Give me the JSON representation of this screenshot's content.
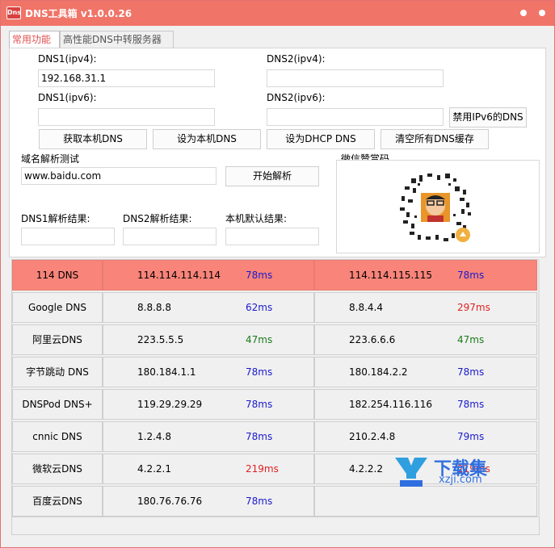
{
  "window": {
    "icon_text": "Dns",
    "title": "DNS工具箱 v1.0.0.26"
  },
  "tabs": [
    {
      "label": "常用功能"
    },
    {
      "label": "高性能DNS中转服务器"
    }
  ],
  "dns_settings": {
    "dns1_ipv4_label": "DNS1(ipv4):",
    "dns1_ipv4_value": "192.168.31.1",
    "dns2_ipv4_label": "DNS2(ipv4):",
    "dns2_ipv4_value": "",
    "dns1_ipv6_label": "DNS1(ipv6):",
    "dns1_ipv6_value": "",
    "dns2_ipv6_label": "DNS2(ipv6):",
    "dns2_ipv6_value": "",
    "disable_ipv6_button": "禁用IPv6的DNS"
  },
  "actions": {
    "get_local_dns": "获取本机DNS",
    "set_local_dns": "设为本机DNS",
    "set_dhcp_dns": "设为DHCP DNS",
    "clear_cache": "清空所有DNS缓存"
  },
  "resolve_test": {
    "section_label": "域名解析测试",
    "domain_value": "www.baidu.com",
    "start_button": "开始解析",
    "dns1_result_label": "DNS1解析结果:",
    "dns2_result_label": "DNS2解析结果:",
    "local_result_label": "本机默认结果:",
    "dns1_result_value": "",
    "dns2_result_value": "",
    "local_result_value": ""
  },
  "donate": {
    "label": "微信赞赏码"
  },
  "servers": [
    {
      "name": "114 DNS",
      "ip1": "114.114.114.114",
      "ms1": "78ms",
      "ms1_color": "blue",
      "ip2": "114.114.115.115",
      "ms2": "78ms",
      "ms2_color": "blue",
      "highlight": true
    },
    {
      "name": "Google DNS",
      "ip1": "8.8.8.8",
      "ms1": "62ms",
      "ms1_color": "blue",
      "ip2": "8.8.4.4",
      "ms2": "297ms",
      "ms2_color": "red",
      "highlight": false
    },
    {
      "name": "阿里云DNS",
      "ip1": "223.5.5.5",
      "ms1": "47ms",
      "ms1_color": "green",
      "ip2": "223.6.6.6",
      "ms2": "47ms",
      "ms2_color": "green",
      "highlight": false
    },
    {
      "name": "字节跳动 DNS",
      "ip1": "180.184.1.1",
      "ms1": "78ms",
      "ms1_color": "blue",
      "ip2": "180.184.2.2",
      "ms2": "78ms",
      "ms2_color": "blue",
      "highlight": false
    },
    {
      "name": "DNSPod DNS+",
      "ip1": "119.29.29.29",
      "ms1": "78ms",
      "ms1_color": "blue",
      "ip2": "182.254.116.116",
      "ms2": "78ms",
      "ms2_color": "blue",
      "highlight": false
    },
    {
      "name": "cnnic DNS",
      "ip1": "1.2.4.8",
      "ms1": "78ms",
      "ms1_color": "blue",
      "ip2": "210.2.4.8",
      "ms2": "79ms",
      "ms2_color": "blue",
      "highlight": false
    },
    {
      "name": "微软云DNS",
      "ip1": "4.2.2.1",
      "ms1": "219ms",
      "ms1_color": "red",
      "ip2": "4.2.2.2",
      "ms2": "219ms",
      "ms2_color": "red",
      "highlight": false
    },
    {
      "name": "百度云DNS",
      "ip1": "180.76.76.76",
      "ms1": "78ms",
      "ms1_color": "blue",
      "ip2": "",
      "ms2": "",
      "ms2_color": "blue",
      "highlight": false
    }
  ],
  "watermark": {
    "text_cn": "下载集",
    "text_url": "xzji.com"
  },
  "colors": {
    "titlebar": "#f07468",
    "highlight_row": "#f8847a",
    "ms_blue": "#1a1acc",
    "ms_green": "#1a7a1a",
    "ms_red": "#e02020"
  }
}
